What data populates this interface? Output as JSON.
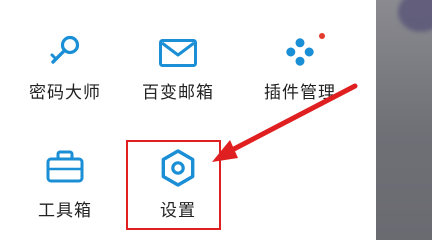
{
  "menu": {
    "items": [
      {
        "label": "密码大师",
        "icon": "key-icon"
      },
      {
        "label": "百变邮箱",
        "icon": "mail-icon"
      },
      {
        "label": "插件管理",
        "icon": "plugin-icon"
      },
      {
        "label": "工具箱",
        "icon": "toolbox-icon"
      },
      {
        "label": "设置",
        "icon": "gear-icon"
      }
    ]
  },
  "annotation": {
    "highlighted_item": "设置",
    "highlight_color": "#e02020"
  },
  "colors": {
    "icon_blue": "#1a8fd6",
    "badge_red": "#e23a2c",
    "label_text": "#222222"
  }
}
